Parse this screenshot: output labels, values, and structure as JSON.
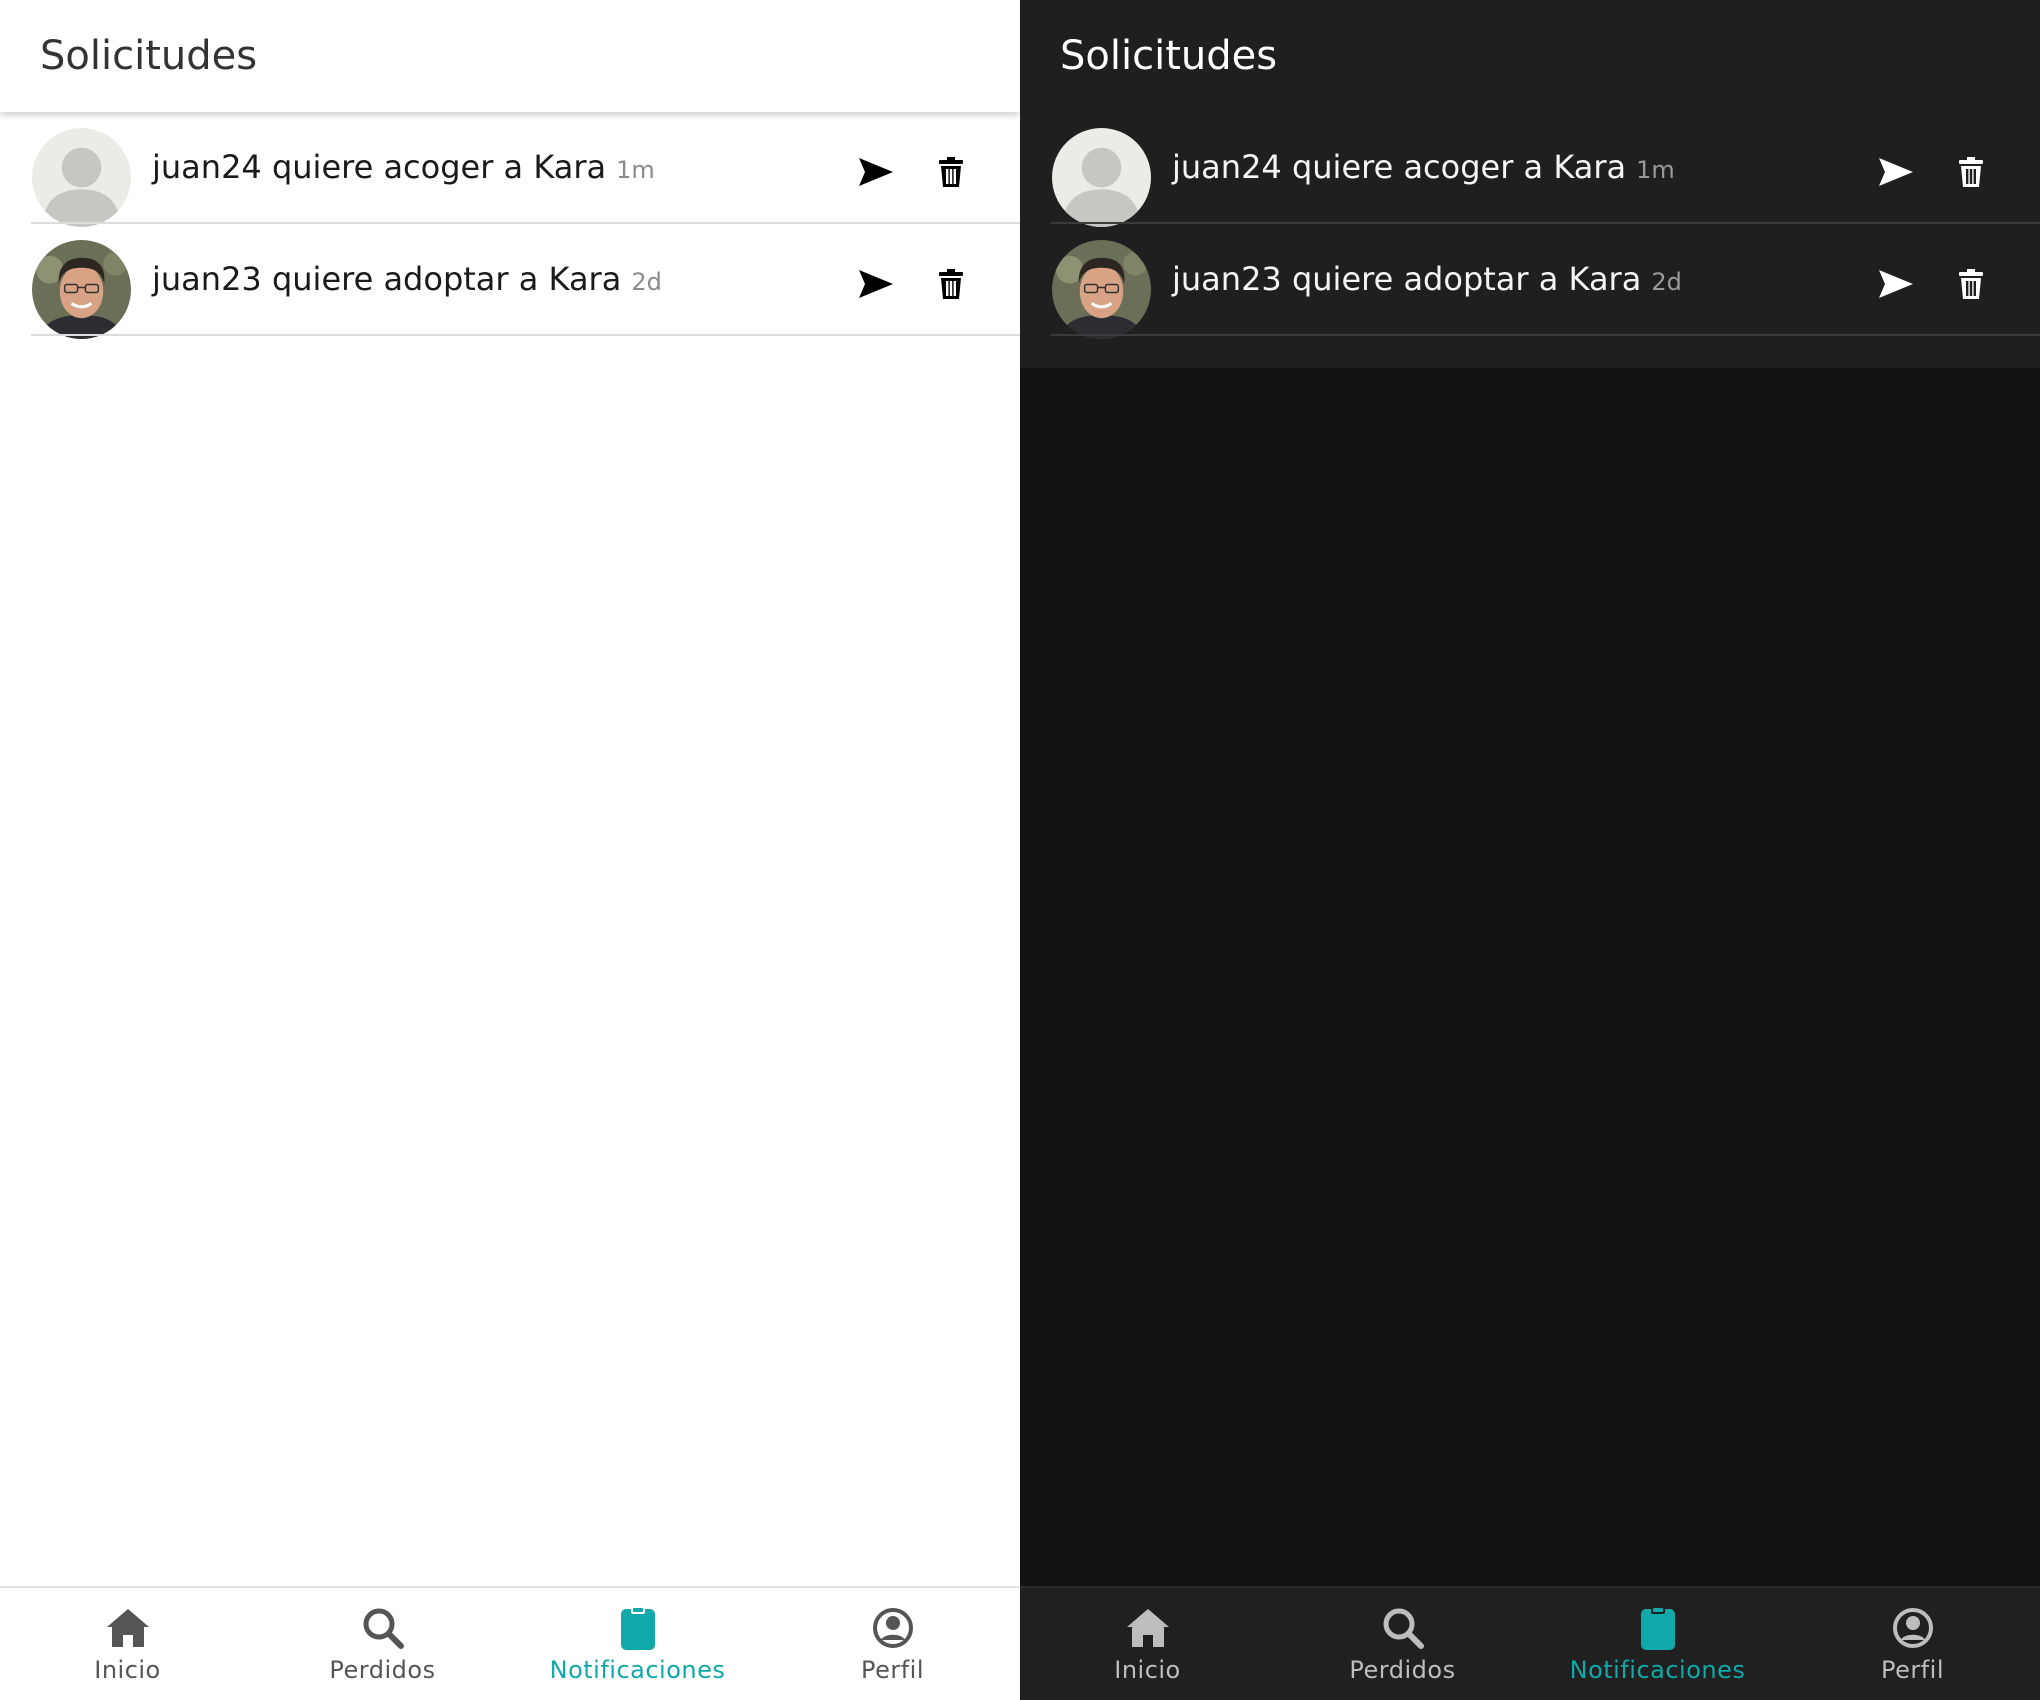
{
  "light": {
    "header": {
      "title": "Solicitudes"
    },
    "requests": [
      {
        "user": "juan24",
        "action": "quiere acoger a",
        "pet": "Kara",
        "time": "1m",
        "avatar": "default-avatar"
      },
      {
        "user": "juan23",
        "action": "quiere adoptar a",
        "pet": "Kara",
        "time": "2d",
        "avatar": "user-photo"
      }
    ],
    "nav": [
      {
        "label": "Inicio",
        "icon": "home-icon"
      },
      {
        "label": "Perdidos",
        "icon": "search-icon"
      },
      {
        "label": "Notificaciones",
        "icon": "clipboard-icon",
        "active": true
      },
      {
        "label": "Perfil",
        "icon": "profile-icon"
      }
    ]
  },
  "dark": {
    "header": {
      "title": "Solicitudes"
    },
    "requests": [
      {
        "user": "juan24",
        "action": "quiere acoger a",
        "pet": "Kara",
        "time": "1m",
        "avatar": "default-avatar"
      },
      {
        "user": "juan23",
        "action": "quiere adoptar a",
        "pet": "Kara",
        "time": "2d",
        "avatar": "user-photo"
      }
    ],
    "nav": [
      {
        "label": "Inicio",
        "icon": "home-icon"
      },
      {
        "label": "Perdidos",
        "icon": "search-icon"
      },
      {
        "label": "Notificaciones",
        "icon": "clipboard-icon",
        "active": true
      },
      {
        "label": "Perfil",
        "icon": "profile-icon"
      }
    ]
  },
  "colors": {
    "accent": "#10a9a9",
    "light_bg": "#ffffff",
    "dark_bg": "#121212",
    "dark_surface": "#1f1f1f"
  }
}
